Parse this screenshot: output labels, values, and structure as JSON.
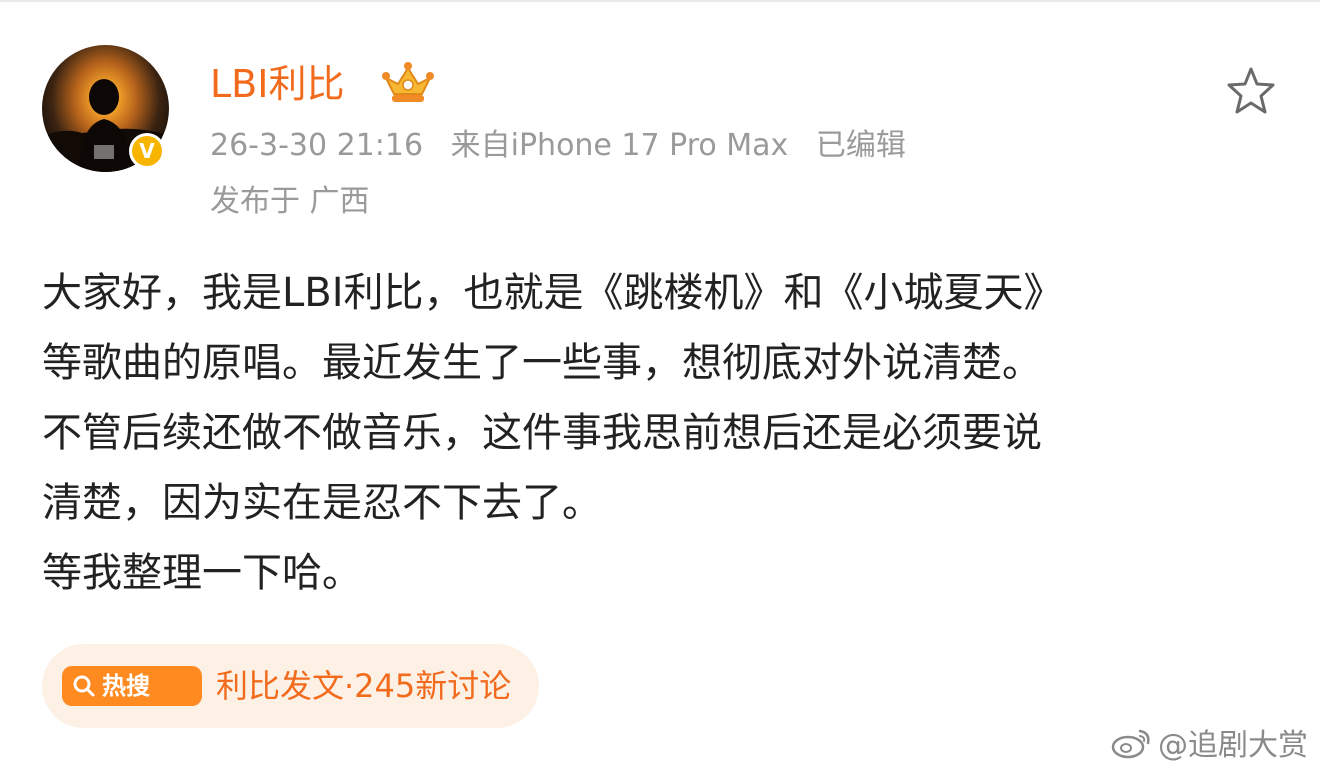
{
  "post": {
    "author": "LBI利比",
    "timestamp": "26-3-30 21:16",
    "device": "来自iPhone 17 Pro Max",
    "edited": "已编辑",
    "location": "发布于 广西",
    "verified_badge": "V",
    "body": [
      "大家好，我是LBI利比，也就是《跳楼机》和《小城夏天》",
      "等歌曲的原唱。最近发生了一些事，想彻底对外说清楚。",
      "不管后续还做不做音乐，这件事我思前想后还是必须要说",
      "清楚，因为实在是忍不下去了。",
      "等我整理一下哈。"
    ]
  },
  "hot_topic": {
    "badge_label": "热搜",
    "text": "利比发文·245新讨论"
  },
  "watermark": {
    "text": "@追剧大赏"
  },
  "icons": {
    "favorite": "star-outline-icon",
    "crown": "crown-icon",
    "search": "search-icon",
    "weibo": "weibo-logo-icon"
  },
  "colors": {
    "accent": "#f26b1d",
    "meta_text": "#9a9a9a",
    "badge_bg": "#ff8a1f",
    "chip_bg": "#fdf1e6",
    "verified": "#f7b500"
  }
}
